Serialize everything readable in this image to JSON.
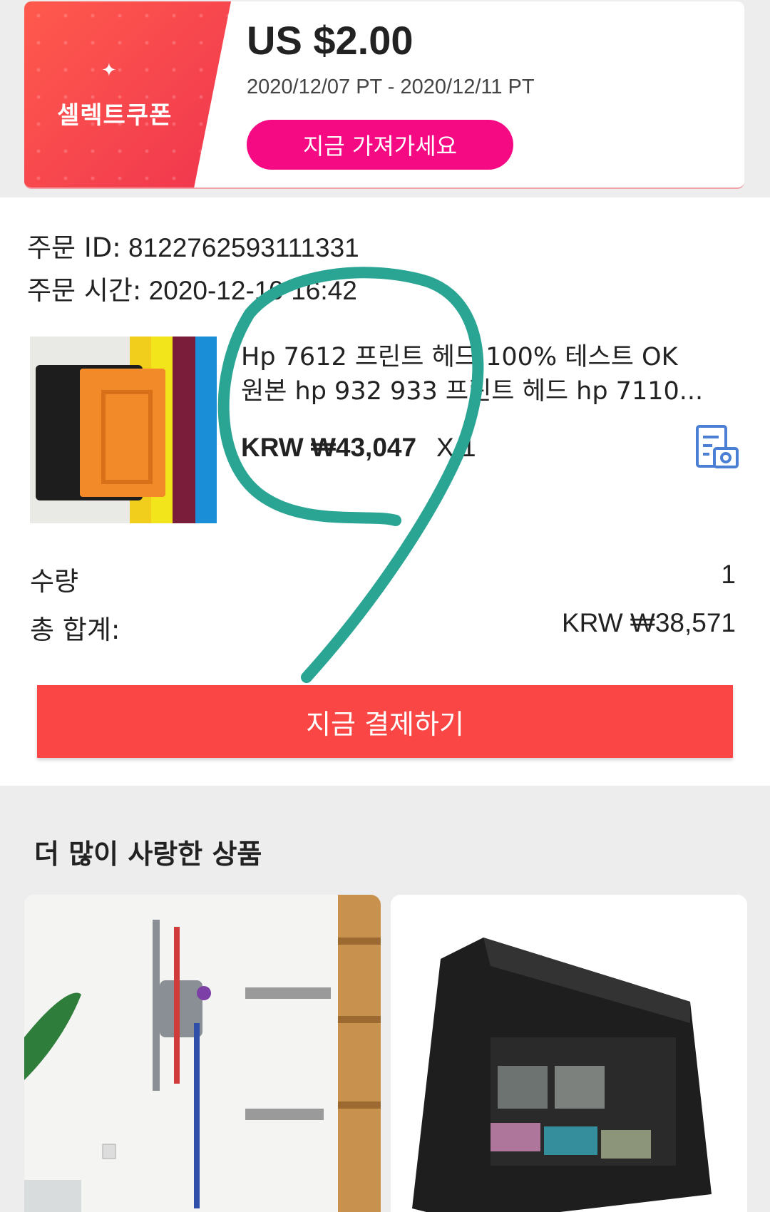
{
  "coupon": {
    "badge_label": "셀렉트쿠폰",
    "amount": "US $2.00",
    "dates": "2020/12/07 PT - 2020/12/11 PT",
    "button_label": "지금 가져가세요",
    "accent_color": "#f50a84"
  },
  "order": {
    "id_label": "주문 ID:",
    "id_value": "8122762593111331",
    "time_label": "주문 시간:",
    "time_value": "2020-12-10 16:42",
    "product": {
      "title_line1": "Hp 7612 프린트 헤드 100% 테스트 OK",
      "title_line2": "원본 hp 932 933 프린트 헤드 hp 7110...",
      "price": "KRW ₩43,047",
      "quantity_suffix": "X 1",
      "photo_icon": "photo-review-icon"
    },
    "quantity_label": "수량",
    "quantity_value": "1",
    "total_label": "총 합계:",
    "total_value": "KRW ₩38,571",
    "pay_button_label": "지금 결제하기",
    "pay_button_color": "#fa4645"
  },
  "more": {
    "title": "더 많이 사랑한 상품"
  }
}
